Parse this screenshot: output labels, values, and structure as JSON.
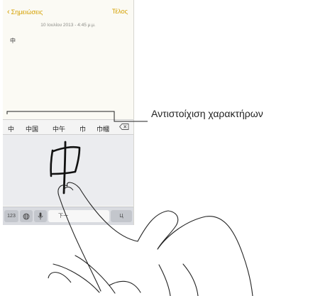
{
  "navbar": {
    "back_label": "Σημειώσεις",
    "done_label": "Τέλος"
  },
  "note": {
    "timestamp": "10 Ιουλίου 2013 - 4:45 μ.μ.",
    "text": "中"
  },
  "candidates": [
    "中",
    "中国",
    "中午",
    "巾",
    "巾幗"
  ],
  "keyboard": {
    "numbers_key": "123",
    "space_key": "下一",
    "right_key": "Ц"
  },
  "callout": {
    "label": "Αντιστοίχιση χαρακτήρων"
  },
  "colors": {
    "accent": "#d4a000",
    "background": "#fbfaf4"
  }
}
